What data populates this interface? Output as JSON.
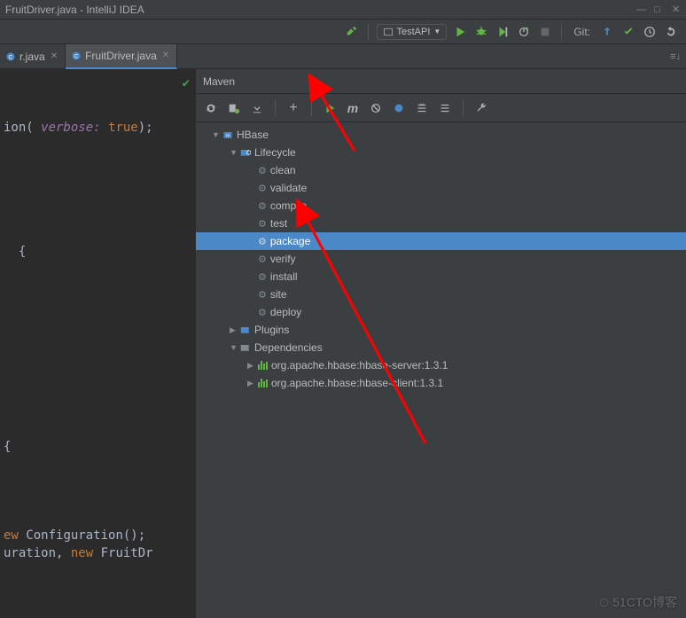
{
  "window": {
    "title": "FruitDriver.java - IntelliJ IDEA"
  },
  "top_toolbar": {
    "run_config": "TestAPI",
    "git_label": "Git:"
  },
  "tabs": {
    "tab1": "r.java",
    "tab2": "FruitDriver.java"
  },
  "maven": {
    "header": "Maven",
    "tree": {
      "root": "HBase",
      "lifecycle": "Lifecycle",
      "goals": {
        "clean": "clean",
        "validate": "validate",
        "compile": "compile",
        "test": "test",
        "package": "package",
        "verify": "verify",
        "install": "install",
        "site": "site",
        "deploy": "deploy"
      },
      "plugins": "Plugins",
      "dependencies": "Dependencies",
      "dep1": "org.apache.hbase:hbase-server:1.3.1",
      "dep2": "org.apache.hbase:hbase-client:1.3.1"
    }
  },
  "code": {
    "line1_a": "ion(",
    "line1_b": " verbose: ",
    "line1_c": "true",
    "line1_d": ");",
    "line2": "{",
    "line3": "{",
    "line4_a": "ew ",
    "line4_b": "Configuration();",
    "line5_a": "uration",
    "line5_b": ", ",
    "line5_c": "new ",
    "line5_d": "FruitDr"
  },
  "watermark": "51CTO博客"
}
